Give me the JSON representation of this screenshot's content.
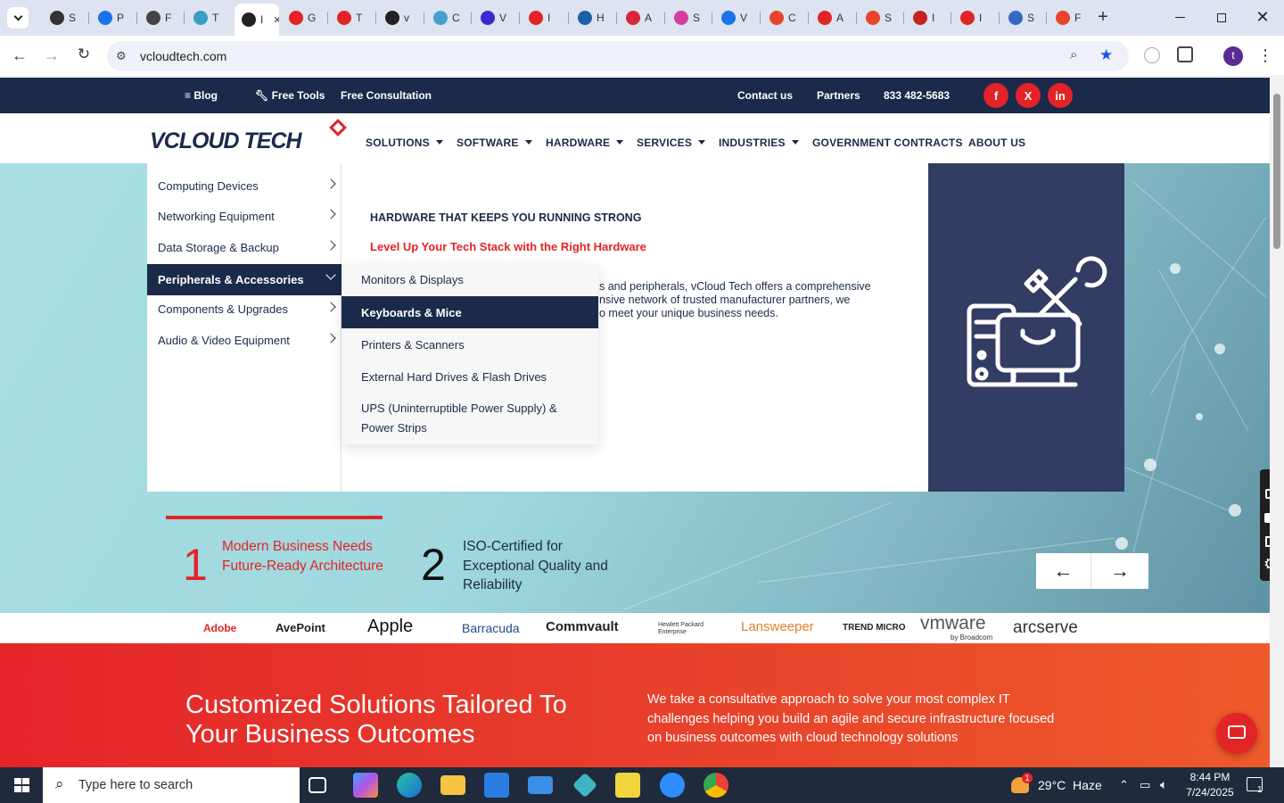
{
  "browser": {
    "tabs": [
      "S",
      "P",
      "F",
      "T",
      "I",
      "G",
      "T",
      "v",
      "C",
      "V",
      "I",
      "H",
      "A",
      "S",
      "V",
      "C",
      "A",
      "S",
      "I",
      "I",
      "S",
      "F"
    ],
    "active_tab_label": "I",
    "url": "vcloudtech.com",
    "profile_initial": "t"
  },
  "topbar": {
    "blog": "Blog",
    "free_tools": "Free Tools",
    "free_consultation": "Free Consultation",
    "contact": "Contact us",
    "partners": "Partners",
    "phone": "833 482-5683",
    "social": {
      "facebook": "f",
      "x": "X",
      "linkedin": "in"
    }
  },
  "logo": {
    "text": "VCLOUD TECH"
  },
  "nav": {
    "solutions": "SOLUTIONS",
    "software": "SOFTWARE",
    "hardware": "HARDWARE",
    "services": "SERVICES",
    "industries": "INDUSTRIES",
    "government": "GOVERNMENT CONTRACTS",
    "about": "ABOUT US"
  },
  "megamenu": {
    "categories": [
      "Computing Devices",
      "Networking Equipment",
      "Data Storage & Backup",
      "Peripherals & Accessories",
      "Components & Upgrades",
      "Audio & Video Equipment"
    ],
    "subitems": [
      "Monitors & Displays",
      "Keyboards & Mice",
      "Printers & Scanners",
      "External Hard Drives & Flash Drives",
      "UPS (Uninterruptible Power Supply) & Power Strips"
    ],
    "heading": "HARDWARE THAT KEEPS YOU RUNNING STRONG",
    "subheading": "Level Up Your Tech Stack with the Right Hardware",
    "body_line1": "s and peripherals, vCloud Tech offers a comprehensive",
    "body_line2": "nsive network of trusted manufacturer partners, we",
    "body_line3": "o meet your unique business needs."
  },
  "features": [
    {
      "num": "1",
      "text": "Modern Business Needs Future-Ready Architecture"
    },
    {
      "num": "2",
      "text": "ISO-Certified for Exceptional Quality and Reliability"
    }
  ],
  "slider": {
    "prev": "←",
    "next": "→"
  },
  "partner_logos": [
    "Adobe",
    "AvePoint",
    "Apple",
    "Barracuda",
    "Commvault",
    "Hewlett Packard Enterprise",
    "Lansweeper",
    "TREND MICRO",
    "vmware",
    "by Broadcom",
    "arcserve"
  ],
  "cta": {
    "title": "Customized Solutions Tailored To Your Business Outcomes",
    "text": "We take a consultative approach to solve your most complex IT challenges helping you build an agile and secure infrastructure focused on business outcomes with cloud technology solutions"
  },
  "taskbar": {
    "search_placeholder": "Type here to search",
    "weather": "29°C  Haze",
    "weather_badge": "1",
    "time": "8:44 PM",
    "date": "7/24/2025",
    "notification_count": "1"
  },
  "colors": {
    "navy": "#1b2a4a",
    "red": "#e32426",
    "panel": "#333c62"
  }
}
